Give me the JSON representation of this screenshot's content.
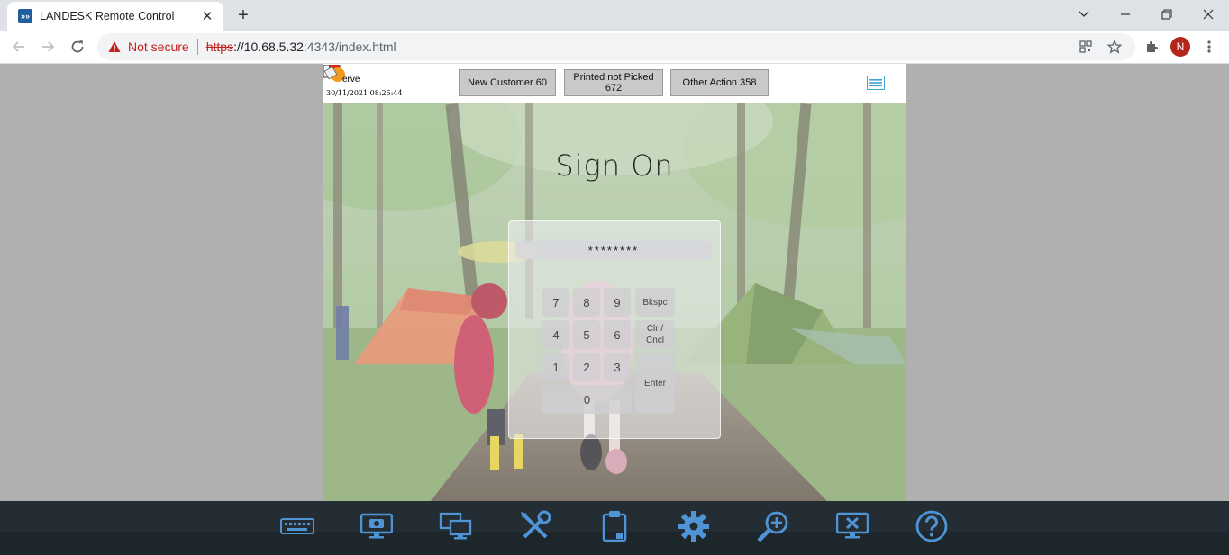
{
  "browser": {
    "tab_title": "LANDESK Remote Control",
    "tab_favicon": "»»",
    "new_tab_icon": "+",
    "security_label": "Not secure",
    "url_scheme": "https",
    "url_host": "://10.68.5.32",
    "url_rest": ":4343/index.html",
    "profile_initial": "N"
  },
  "app": {
    "name": "erve",
    "datetime": "30/11/2021 08:25:44",
    "buttons": [
      {
        "label": "New Customer 60"
      },
      {
        "label": "Printed not Picked 672"
      },
      {
        "label": "Other Action 358"
      }
    ],
    "signon_title": "Sign On",
    "pin_value": "********",
    "keys": {
      "k7": "7",
      "k8": "8",
      "k9": "9",
      "bkspc": "Bkspc",
      "k4": "4",
      "k5": "5",
      "k6": "6",
      "clr": "Clr / Cncl",
      "k1": "1",
      "k2": "2",
      "k3": "3",
      "enter": "Enter",
      "k0": "0"
    }
  },
  "rc_toolbar": {
    "icons": [
      "keyboard-icon",
      "screenshot-icon",
      "multi-monitor-icon",
      "tools-icon",
      "clipboard-icon",
      "settings-gear-icon",
      "zoom-in-icon",
      "disconnect-icon",
      "help-icon"
    ]
  },
  "colors": {
    "chrome_bg": "#dee1e6",
    "not_secure_red": "#c5221f",
    "rc_toolbar_bg": "#232d33",
    "rc_icon_blue": "#4f95d6"
  }
}
